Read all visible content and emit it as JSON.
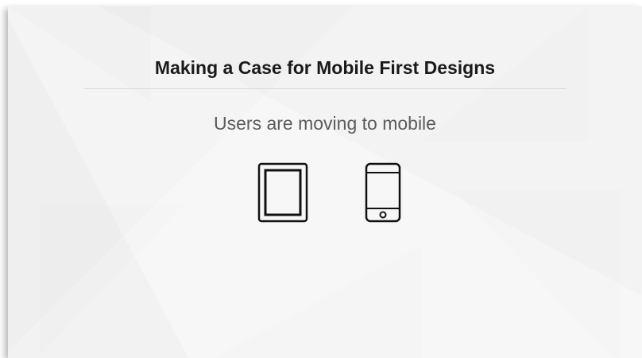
{
  "slide": {
    "title": "Making a Case for Mobile First Designs",
    "subtitle": "Users are moving to mobile"
  },
  "icons": [
    "tablet-icon",
    "smartphone-icon"
  ],
  "colors": {
    "background": "#f7f7f7",
    "title": "#1a1a1a",
    "subtitle": "#5b5b5b",
    "divider": "#d9d9d9",
    "icon_stroke": "#111111"
  }
}
